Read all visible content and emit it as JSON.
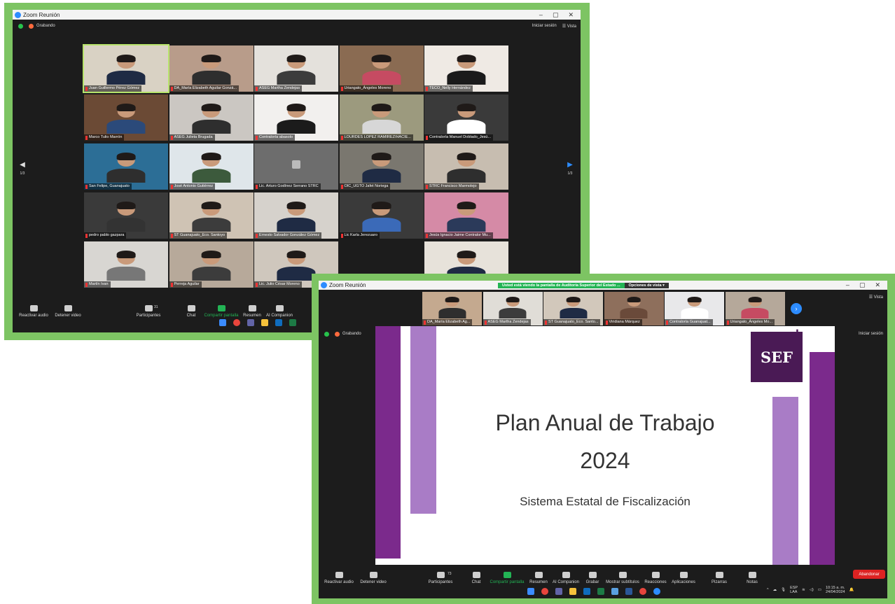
{
  "window1": {
    "title": "Zoom Reunión",
    "recording": "Grabando",
    "login": "Iniciar sesión",
    "view": "Vista",
    "page_left": "1/3",
    "page_right": "1/3",
    "participants": [
      "Juan Guillermo Pérez Gómez",
      "DA_María Elizabeth Aguilar Gonzá...",
      "ASEG Martha Zendejas",
      "Uriangato_Ángeles Moreno",
      "TECO_Nelly Hernández",
      "Marco Tulio Marrón",
      "ASEG Julieta Brugada",
      "Contraloría abasolo",
      "LOURDES LOPEZ RAMIREZ/HACIE...",
      "Contraloría Manuel Doblado_Jesú...",
      "San Felipe, Guanajuato",
      "José Antonio Gutiérrez",
      "Lic. Arturo Godínez Serrano STRC",
      "OIC_UGTO Jafet Noriega",
      "STRC Francisco Marmolejo",
      "pedro pablo gazpara",
      "ST Guanajuato_Eco. Santoyo",
      "Ernesto Salvador González Gómez",
      "Lic Karla Jerezuaro",
      "Jesús Ignacio Jaime Contralor Mu...",
      "Martín Ivan",
      "Perreja Aguilar",
      "Lic. Julio César Moreno",
      "",
      ""
    ],
    "toolbar": {
      "audio": "Reactivar audio",
      "video": "Detener video",
      "participants": "Participantes",
      "participants_count": "31",
      "chat": "Chat",
      "share": "Compartir pantalla",
      "summary": "Resumen",
      "companion": "AI Companion"
    }
  },
  "window2": {
    "title": "Zoom Reunión",
    "share_notice": "Usted está viendo la pantalla de Auditoría Superior del Estado ...",
    "view_options": "Opciones de vista",
    "view": "Vista",
    "recording": "Grabando",
    "login": "Iniciar sesión",
    "strip": [
      "DA_María Elizabeth Ag...",
      "ASEG Martha Zendejas",
      "ST Guanajuato_Eco. Santo...",
      "Viridiana Márquez",
      "Contraloría Guanajuat...",
      "Uriangato_Ángeles Mo..."
    ],
    "slide": {
      "title_line1": "Plan Anual de Trabajo",
      "title_line2": "2024",
      "subtitle": "Sistema Estatal de Fiscalización",
      "logo": "SEF",
      "logo_plus": "+"
    },
    "toolbar": {
      "audio": "Reactivar audio",
      "video": "Detener video",
      "participants": "Participantes",
      "participants_count": "73",
      "chat": "Chat",
      "share": "Compartir pantalla",
      "summary": "Resumen",
      "companion": "AI Companion",
      "record": "Grabar",
      "captions": "Mostrar subtítulos",
      "reactions": "Reacciones",
      "apps": "Aplicaciones",
      "whiteboards": "Pizarras",
      "notes": "Notas",
      "leave": "Abandonar"
    },
    "tray": {
      "lang1": "ESP",
      "lang2": "LAA",
      "time": "10:15 a. m.",
      "date": "24/04/2024"
    }
  },
  "colors": {
    "frame_green": "#7dc463",
    "zoom_dark": "#1c1c1c",
    "purple_dark": "#7b2a8c",
    "purple_light": "#a97cc6",
    "sef_purple": "#4a1a55",
    "leave_red": "#dd2222"
  }
}
